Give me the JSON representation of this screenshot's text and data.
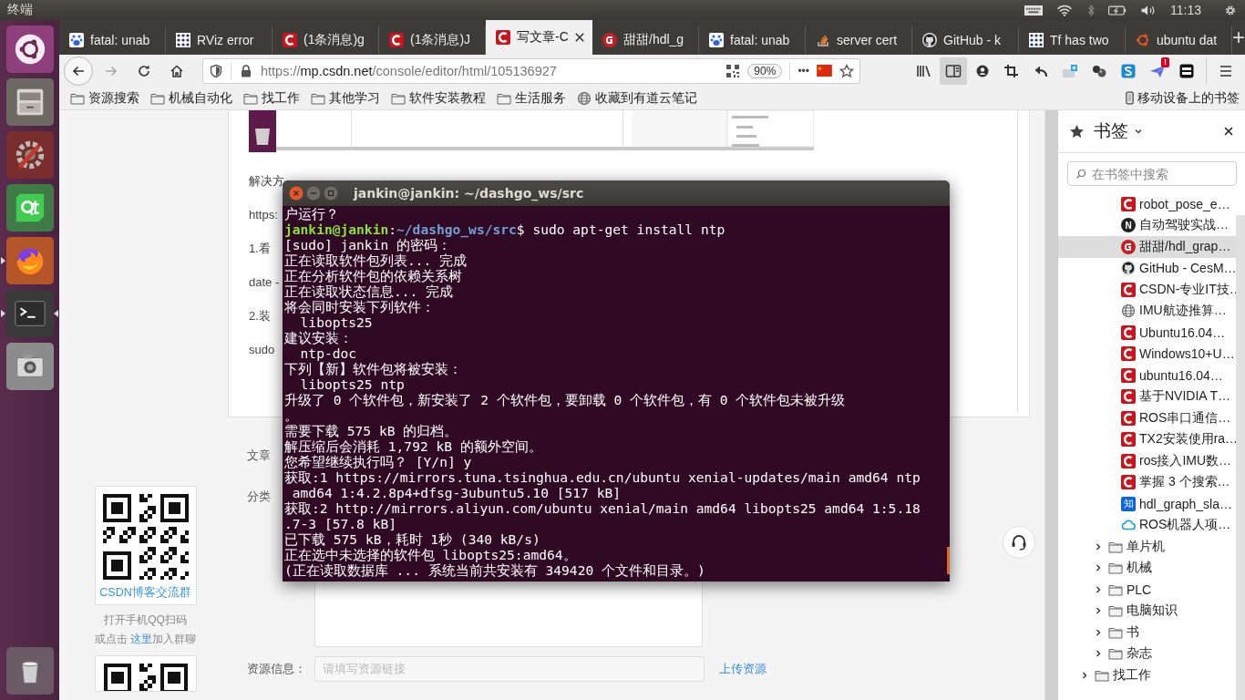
{
  "top_panel": {
    "app_title": "终端",
    "clock": "11:13"
  },
  "launcher": [
    {
      "kind": "dash",
      "running": false,
      "focused": false
    },
    {
      "kind": "files",
      "running": false,
      "focused": false
    },
    {
      "kind": "settings",
      "running": false,
      "focused": false
    },
    {
      "kind": "qt",
      "running": false,
      "focused": false
    },
    {
      "kind": "firefox",
      "running": true,
      "focused": false
    },
    {
      "kind": "terminal",
      "running": true,
      "focused": true
    },
    {
      "kind": "camera",
      "running": false,
      "focused": false
    },
    {
      "kind": "trash",
      "running": false,
      "focused": false
    }
  ],
  "tabs": [
    {
      "kind": "baidu",
      "title": "fatal: unab",
      "selected": false
    },
    {
      "kind": "dots",
      "title": "RViz error",
      "selected": false
    },
    {
      "kind": "csdn",
      "title": "(1条消息)g",
      "selected": false
    },
    {
      "kind": "csdn",
      "title": "(1条消息)J",
      "selected": false
    },
    {
      "kind": "csdn",
      "title": "写文章-C",
      "selected": true
    },
    {
      "kind": "gitee",
      "title": "甜甜/hdl_g",
      "selected": false
    },
    {
      "kind": "baidu",
      "title": "fatal: unab",
      "selected": false
    },
    {
      "kind": "stack",
      "title": "server cert",
      "selected": false
    },
    {
      "kind": "github",
      "title": "GitHub - k",
      "selected": false
    },
    {
      "kind": "dots",
      "title": "Tf has two",
      "selected": false
    },
    {
      "kind": "ubuntu",
      "title": "ubuntu dat",
      "selected": false
    }
  ],
  "new_tab": "+",
  "navigation": {
    "url": {
      "scheme": "https://",
      "host": "mp.csdn.net",
      "path": "/console/editor/html/105136927"
    },
    "zoom": "90%",
    "more": "•••"
  },
  "toolbar": [
    {
      "kind": "library",
      "selected": false
    },
    {
      "kind": "sidebar",
      "selected": true
    },
    {
      "kind": "account",
      "selected": false
    },
    {
      "kind": "crop",
      "selected": false
    },
    {
      "kind": "undo",
      "selected": false
    },
    {
      "kind": "note",
      "selected": false
    },
    {
      "kind": "balls",
      "selected": false
    },
    {
      "kind": "square",
      "selected": false
    },
    {
      "kind": "plane",
      "selected": false,
      "badge": "!"
    },
    {
      "kind": "server",
      "selected": false
    },
    {
      "kind": "menu",
      "selected": false
    }
  ],
  "bookmarks_toolbar": {
    "items": [
      {
        "kind": "folder",
        "label": "资源搜索"
      },
      {
        "kind": "folder",
        "label": "机械自动化"
      },
      {
        "kind": "folder",
        "label": "找工作"
      },
      {
        "kind": "folder",
        "label": "其他学习"
      },
      {
        "kind": "folder",
        "label": "软件安装教程"
      },
      {
        "kind": "folder",
        "label": "生活服务"
      },
      {
        "kind": "web",
        "label": "收藏到有道云笔记"
      }
    ],
    "mobile": "移动设备上的书签"
  },
  "editor": {
    "heading": "解决方",
    "link": "https:",
    "paragraphs": [
      "1.看",
      "date -",
      "2.装",
      "sudo"
    ]
  },
  "form": {
    "tag_label": "文章",
    "category_label": "分类",
    "resource_label": "资源信息：",
    "resource_placeholder": "请填写资源链接",
    "upload_link": "上传资源"
  },
  "qq_group": {
    "card_title": "CSDN博客交流群",
    "instruction": "打开手机QQ扫码",
    "join_prefix": "或点击 ",
    "join_link": "这里",
    "join_suffix": "加入群聊"
  },
  "terminal": {
    "title": "jankin@jankin: ~/dashgo_ws/src",
    "lines": [
      {
        "kind": "output",
        "text": "户运行？"
      },
      {
        "kind": "prompt",
        "user": "jankin@jankin",
        "colon": ":",
        "path": "~/dashgo_ws/src",
        "dollar": "$",
        "command": " sudo apt-get install ntp"
      },
      {
        "kind": "output",
        "text": "[sudo] jankin 的密码："
      },
      {
        "kind": "output",
        "text": "正在读取软件包列表... 完成"
      },
      {
        "kind": "output",
        "text": "正在分析软件包的依赖关系树"
      },
      {
        "kind": "output",
        "text": "正在读取状态信息... 完成"
      },
      {
        "kind": "output",
        "text": "将会同时安装下列软件："
      },
      {
        "kind": "output",
        "text": "  libopts25"
      },
      {
        "kind": "output",
        "text": "建议安装："
      },
      {
        "kind": "output",
        "text": "  ntp-doc"
      },
      {
        "kind": "output",
        "text": "下列【新】软件包将被安装："
      },
      {
        "kind": "output",
        "text": "  libopts25 ntp"
      },
      {
        "kind": "output",
        "text": "升级了 0 个软件包，新安装了 2 个软件包，要卸载 0 个软件包，有 0 个软件包未被升级"
      },
      {
        "kind": "output",
        "text": "。"
      },
      {
        "kind": "output",
        "text": "需要下载 575 kB 的归档。"
      },
      {
        "kind": "output",
        "text": "解压缩后会消耗 1,792 kB 的额外空间。"
      },
      {
        "kind": "output",
        "text": "您希望继续执行吗？ [Y/n] y"
      },
      {
        "kind": "output",
        "text": "获取:1 https://mirrors.tuna.tsinghua.edu.cn/ubuntu xenial-updates/main amd64 ntp"
      },
      {
        "kind": "output",
        "text": " amd64 1:4.2.8p4+dfsg-3ubuntu5.10 [517 kB]"
      },
      {
        "kind": "output",
        "text": "获取:2 http://mirrors.aliyun.com/ubuntu xenial/main amd64 libopts25 amd64 1:5.18"
      },
      {
        "kind": "output",
        "text": ".7-3 [57.8 kB]"
      },
      {
        "kind": "output",
        "text": "已下载 575 kB，耗时 1秒 (340 kB/s)"
      },
      {
        "kind": "output",
        "text": "正在选中未选择的软件包 libopts25:amd64。"
      },
      {
        "kind": "output",
        "text": "(正在读取数据库 ... 系统当前共安装有 349420 个文件和目录。)"
      }
    ]
  },
  "sidebar": {
    "title": "书签",
    "search_placeholder": "在书签中搜索",
    "tree": [
      {
        "kind": "contents",
        "children": [
          {
            "kind": "csdn",
            "label": "robot_pose_e…",
            "selected": false
          },
          {
            "kind": "hexagon",
            "glyph": "N",
            "label": "自动驾驶实战…",
            "selected": false
          },
          {
            "kind": "gitee",
            "label": "甜甜/hdl_grap…",
            "selected": true
          },
          {
            "kind": "github",
            "label": "GitHub - CesM…",
            "selected": false
          },
          {
            "kind": "csdn",
            "label": "CSDN-专业IT技…",
            "selected": false
          },
          {
            "kind": "globe",
            "label": "IMU航迹推算…",
            "selected": false
          },
          {
            "kind": "csdn",
            "label": "Ubuntu16.04…",
            "selected": false
          },
          {
            "kind": "csdn",
            "label": "Windows10+U…",
            "selected": false
          },
          {
            "kind": "csdn",
            "label": "ubuntu16.04…",
            "selected": false
          },
          {
            "kind": "csdn",
            "label": "基于NVIDIA T…",
            "selected": false
          },
          {
            "kind": "csdn",
            "label": "ROS串口通信…",
            "selected": false
          },
          {
            "kind": "csdn",
            "label": "TX2安装使用ra…",
            "selected": false
          },
          {
            "kind": "csdn",
            "label": "ros接入IMU数…",
            "selected": false
          },
          {
            "kind": "csdn",
            "label": "掌握 3 个搜索…",
            "selected": false
          },
          {
            "kind": "zhihu",
            "glyph": "知",
            "label": "hdl_graph_sla…",
            "selected": false
          },
          {
            "kind": "cloud",
            "label": "ROS机器人项…",
            "selected": false
          },
          {
            "kind": "folder",
            "label": "单片机",
            "expanded": false,
            "selected": false
          },
          {
            "kind": "folder",
            "label": "机械",
            "expanded": false,
            "selected": false
          },
          {
            "kind": "folder",
            "label": "PLC",
            "expanded": false,
            "selected": false
          },
          {
            "kind": "folder",
            "label": "电脑知识",
            "expanded": false,
            "selected": false
          },
          {
            "kind": "folder",
            "label": "书",
            "expanded": false,
            "selected": false
          },
          {
            "kind": "folder",
            "label": "杂志",
            "expanded": false,
            "selected": false
          }
        ]
      },
      {
        "kind": "folder",
        "label": "找工作",
        "expanded": false,
        "selected": false
      }
    ]
  }
}
